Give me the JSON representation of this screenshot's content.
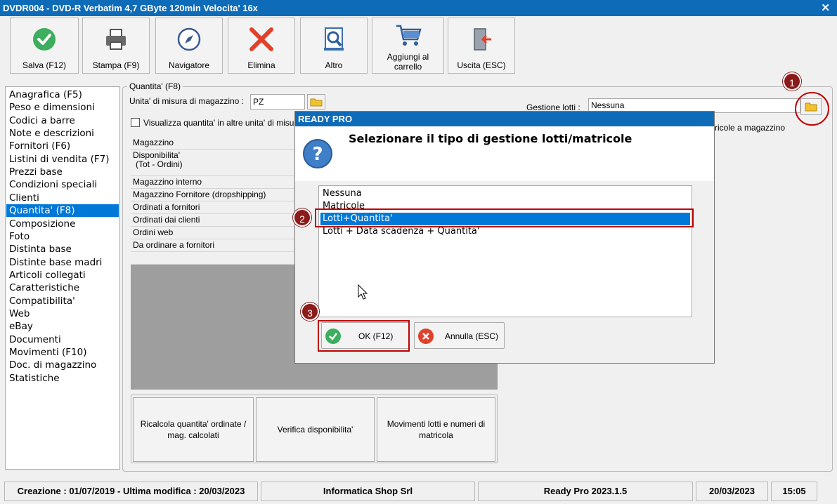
{
  "window": {
    "title": "DVDR004 - DVD-R Verbatim 4,7 GByte 120min  Velocita' 16x",
    "close": "✕"
  },
  "toolbar": {
    "save": "Salva (F12)",
    "print": "Stampa (F9)",
    "navigator": "Navigatore",
    "delete": "Elimina",
    "other": "Altro",
    "cart_line1": "Aggiungi al",
    "cart_line2": "carrello",
    "exit": "Uscita (ESC)"
  },
  "sidebar": {
    "items": [
      {
        "label": "Anagrafica (F5)"
      },
      {
        "label": "Peso e dimensioni"
      },
      {
        "label": "Codici a barre"
      },
      {
        "label": "Note e descrizioni"
      },
      {
        "label": "Fornitori (F6)"
      },
      {
        "label": "Listini di vendita (F7)"
      },
      {
        "label": "Prezzi base"
      },
      {
        "label": "Condizioni speciali"
      },
      {
        "label": "Clienti"
      },
      {
        "label": "Quantita' (F8)"
      },
      {
        "label": "Composizione"
      },
      {
        "label": "Foto"
      },
      {
        "label": "Distinta base"
      },
      {
        "label": "Distinte base madri"
      },
      {
        "label": "Articoli collegati"
      },
      {
        "label": "Caratteristiche"
      },
      {
        "label": "Compatibilita'"
      },
      {
        "label": "Web"
      },
      {
        "label": "eBay"
      },
      {
        "label": "Documenti"
      },
      {
        "label": "Movimenti (F10)"
      },
      {
        "label": "Doc. di magazzino"
      },
      {
        "label": "Statistiche"
      }
    ],
    "selected_index": 9
  },
  "quantity": {
    "group_title": "Quantita' (F8)",
    "unit_label": "Unita' di misura di magazzino :",
    "unit_value": "PZ",
    "show_other_units_label": "Visualizza quantita' in altre unita' di misu",
    "lots_label": "Gestione lotti :",
    "lots_value": "Nessuna",
    "right_text": "ricole a magazzino",
    "grid_rows": [
      "Magazzino",
      "Disponibilita'",
      "(Tot - Ordini)",
      "Magazzino interno",
      "Magazzino Fornitore (dropshipping)",
      "Ordinati a fornitori",
      "Ordinati dai clienti",
      "Ordini web",
      "Da ordinare a fornitori"
    ],
    "btn_recalc_line1": "Ricalcola quantita' ordinate /",
    "btn_recalc_line2": "mag. calcolati",
    "btn_verify": "Verifica disponibilita'",
    "btn_moves_line1": "Movimenti lotti e numeri di",
    "btn_moves_line2": "matricola"
  },
  "dialog": {
    "title": "READY PRO",
    "question": "Selezionare il tipo di gestione lotti/matricole",
    "options": [
      "Nessuna",
      "Matricole",
      "Lotti+Quantita'",
      "Lotti + Data scadenza + Quantita'"
    ],
    "selected_index": 2,
    "ok": "OK (F12)",
    "cancel": "Annulla (ESC)"
  },
  "badges": {
    "b1": "1",
    "b2": "2",
    "b3": "3"
  },
  "status": {
    "dates": "Creazione : 01/07/2019 - Ultima modifica : 20/03/2023",
    "company": "Informatica Shop Srl",
    "version": "Ready Pro 2023.1.5",
    "date": "20/03/2023",
    "time": "15:05"
  },
  "colors": {
    "titlebar": "#0e6bb8",
    "selection": "#0078d7",
    "highlight": "#c00000",
    "badge": "#8b1a1a"
  }
}
